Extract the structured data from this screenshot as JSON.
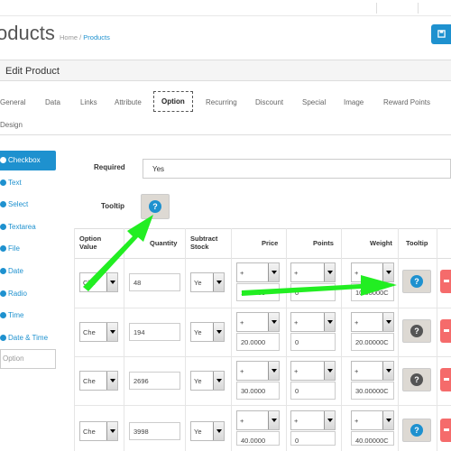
{
  "header": {
    "title": "oducts",
    "breadcrumb": {
      "home": "Home",
      "separator": "/",
      "current": "Products"
    },
    "save_icon": "save-icon"
  },
  "panel": {
    "title": "Edit Product"
  },
  "tabs": [
    "General",
    "Data",
    "Links",
    "Attribute",
    "Option",
    "Recurring",
    "Discount",
    "Special",
    "Image",
    "Reward Points",
    "Design"
  ],
  "active_tab": "Option",
  "options_sidebar": {
    "items": [
      "Checkbox",
      "Text",
      "Select",
      "Textarea",
      "File",
      "Date",
      "Radio",
      "Time",
      "Date & Time"
    ],
    "active": "Checkbox",
    "input_placeholder": "Option"
  },
  "form": {
    "required_label": "Required",
    "required_value": "Yes",
    "tooltip_label": "Tooltip"
  },
  "table": {
    "headers": [
      "Option Value",
      "Quantity",
      "Subtract Stock",
      "Price",
      "Points",
      "Weight",
      "Tooltip"
    ],
    "rows": [
      {
        "option_value": "Che",
        "quantity": "48",
        "subtract": "Ye",
        "price_prefix": "+",
        "price": "10.0000",
        "points_prefix": "+",
        "points": "0",
        "weight_prefix": "+",
        "weight": "10.00000C"
      },
      {
        "option_value": "Che",
        "quantity": "194",
        "subtract": "Ye",
        "price_prefix": "+",
        "price": "20.0000",
        "points_prefix": "+",
        "points": "0",
        "weight_prefix": "+",
        "weight": "20.00000C"
      },
      {
        "option_value": "Che",
        "quantity": "2696",
        "subtract": "Ye",
        "price_prefix": "+",
        "price": "30.0000",
        "points_prefix": "+",
        "points": "0",
        "weight_prefix": "+",
        "weight": "30.00000C"
      },
      {
        "option_value": "Che",
        "quantity": "3998",
        "subtract": "Ye",
        "price_prefix": "+",
        "price": "40.0000",
        "points_prefix": "+",
        "points": "0",
        "weight_prefix": "+",
        "weight": "40.00000C"
      }
    ]
  },
  "colors": {
    "accent": "#1e91cf",
    "danger": "#f56b6b",
    "annotation_arrow": "#22ee22"
  }
}
